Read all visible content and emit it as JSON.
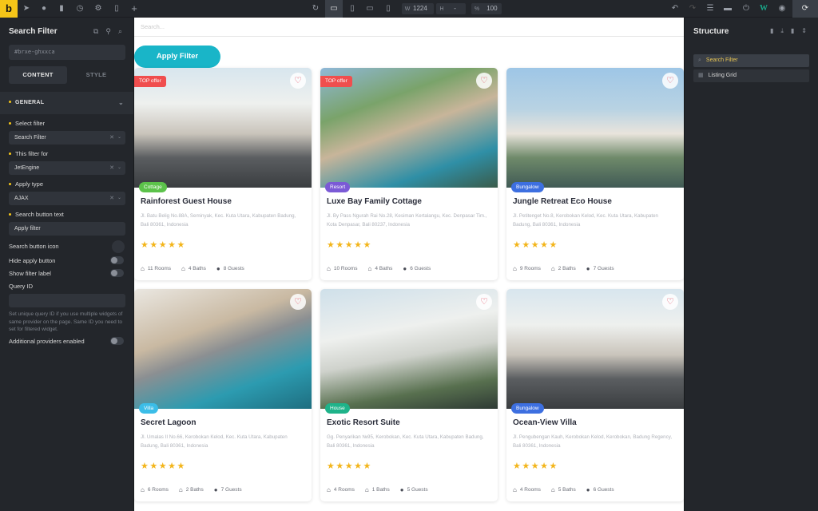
{
  "toolbar": {
    "logo": "b",
    "left_icons": [
      "cursor-icon",
      "help-icon",
      "pages-icon",
      "history-icon",
      "settings-icon",
      "css-icon",
      "add-icon"
    ],
    "width_key": "W",
    "width_value": "1224",
    "height_key": "H",
    "height_value": "-",
    "zoom_key": "%",
    "zoom_value": "100",
    "breakpoints": [
      "desktop",
      "tablet-portrait",
      "mobile-landscape",
      "mobile-portrait"
    ],
    "active_breakpoint": "desktop"
  },
  "left_panel": {
    "title": "Search Filter",
    "element_id": "#brxe-ghxxca",
    "tabs": [
      {
        "label": "CONTENT",
        "active": true
      },
      {
        "label": "STYLE",
        "active": false
      }
    ],
    "group": "GENERAL",
    "controls": {
      "select_filter": {
        "label": "Select filter",
        "value": "Search Filter"
      },
      "filter_for": {
        "label": "This filter for",
        "value": "JetEngine"
      },
      "apply_type": {
        "label": "Apply type",
        "value": "AJAX"
      },
      "button_text": {
        "label": "Search button text",
        "value": "Apply filter"
      },
      "button_icon": {
        "label": "Search button icon"
      },
      "hide_apply": {
        "label": "Hide apply button",
        "on": false
      },
      "show_label": {
        "label": "Show filter label",
        "on": false
      },
      "query_id": {
        "label": "Query ID",
        "value": ""
      },
      "query_help": "Set unique query ID if you use multiple widgets of same provider on the page. Same ID you need to set for filtered widget.",
      "additional": {
        "label": "Additional providers enabled",
        "on": false
      }
    }
  },
  "canvas": {
    "search_placeholder": "Search...",
    "apply_button": "Apply Filter",
    "listings": [
      {
        "title": "Rainforest Guest House",
        "address": "Jl. Batu Belig No.88A, Seminyak, Kec. Kuta Utara, Kabupaten Badung, Bali 80361, Indonesia",
        "category": "Cottage",
        "cat_color": "#5cc24a",
        "top_offer": "TOP offer",
        "rating": 5,
        "rooms": "11 Rooms",
        "baths": "4 Baths",
        "guests": "8 Guests"
      },
      {
        "title": "Luxe Bay Family Cottage",
        "address": "Jl. By Pass Ngurah Rai No.28, Kesiman Kertalangu, Kec. Denpasar Tim., Kota Denpasar, Bali 80237, Indonesia",
        "category": "Resort",
        "cat_color": "#7b5ad6",
        "top_offer": "TOP offer",
        "rating": 5,
        "rooms": "10 Rooms",
        "baths": "4 Baths",
        "guests": "6 Guests"
      },
      {
        "title": "Jungle Retreat Eco House",
        "address": "Jl. Petitenget No.8, Kerobokan Kelod, Kec. Kuta Utara, Kabupaten Badung, Bali 80361, Indonesia",
        "category": "Bungalow",
        "cat_color": "#3d6fe0",
        "top_offer": null,
        "rating": 5,
        "rooms": "9 Rooms",
        "baths": "2 Baths",
        "guests": "7 Guests"
      },
      {
        "title": "Secret Lagoon",
        "address": "Jl. Umalas II No.66, Kerobokan Kelod, Kec. Kuta Utara, Kabupaten Badung, Bali 80361, Indonesia",
        "category": "Villa",
        "cat_color": "#3bbde8",
        "top_offer": null,
        "rating": 5,
        "rooms": "6 Rooms",
        "baths": "2 Baths",
        "guests": "7 Guests"
      },
      {
        "title": "Exotic Resort Suite",
        "address": "Gg. Penyarikan №95, Kerobokan, Kec. Kuta Utara, Kabupaten Badung, Bali 80361, Indonesia",
        "category": "House",
        "cat_color": "#1fb38a",
        "top_offer": null,
        "rating": 5,
        "rooms": "4 Rooms",
        "baths": "1 Baths",
        "guests": "5 Guests"
      },
      {
        "title": "Ocean-View Villa",
        "address": "Jl. Pengubengan Kauh, Kerobokan Kelod, Kerobokan, Badung Regency, Bali 80361, Indonesia",
        "category": "Bungalow",
        "cat_color": "#3d6fe0",
        "top_offer": null,
        "rating": 5,
        "rooms": "4 Rooms",
        "baths": "5 Baths",
        "guests": "6 Guests"
      }
    ]
  },
  "right_panel": {
    "title": "Structure",
    "items": [
      {
        "label": "Search Filter",
        "icon": "search-filter-icon",
        "active": true
      },
      {
        "label": "Listing Grid",
        "icon": "grid-icon",
        "active": false
      }
    ]
  },
  "colors": {
    "accent": "#f5c518",
    "apply": "#19b5c8",
    "top_offer": "#f04e4e",
    "star": "#f3b51b"
  }
}
